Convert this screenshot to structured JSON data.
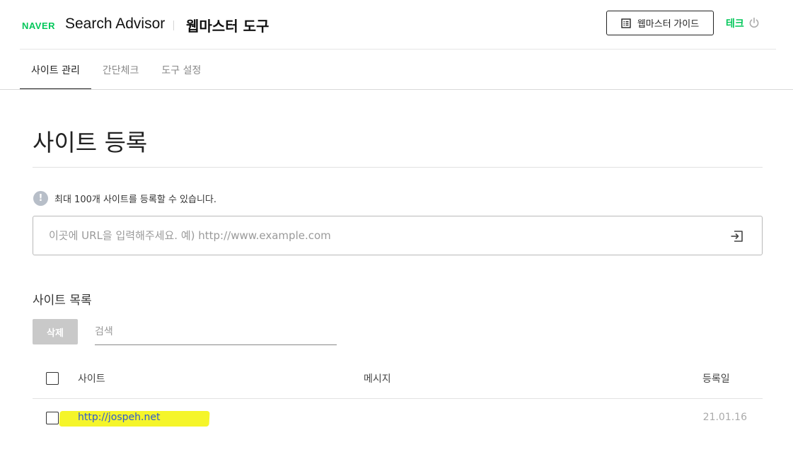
{
  "header": {
    "logo_text": "NAVER",
    "brand_title": "Search Advisor",
    "tool_title": "웹마스터 도구",
    "guide_button_label": "웹마스터 가이드",
    "guide_icon": "book-list-icon",
    "user_name": "테크",
    "logout_icon": "power-icon",
    "accent_color": "#03c75a"
  },
  "tabs": [
    {
      "label": "사이트 관리",
      "active": true
    },
    {
      "label": "간단체크",
      "active": false
    },
    {
      "label": "도구 설정",
      "active": false
    }
  ],
  "main": {
    "page_title": "사이트 등록",
    "notice_text": "최대 100개 사이트를 등록할 수 있습니다.",
    "notice_icon": "info-icon",
    "url_input": {
      "value": "",
      "placeholder": "이곳에 URL을 입력해주세요. 예) http://www.example.com"
    },
    "submit_icon": "enter-icon"
  },
  "site_list": {
    "title": "사이트 목록",
    "delete_button_label": "삭제",
    "search_placeholder": "검색",
    "columns": {
      "site": "사이트",
      "message": "메시지",
      "registered_date": "등록일"
    },
    "rows": [
      {
        "site": "http://jospeh.net",
        "message": "",
        "date": "21.01.16",
        "checked": false
      }
    ]
  }
}
